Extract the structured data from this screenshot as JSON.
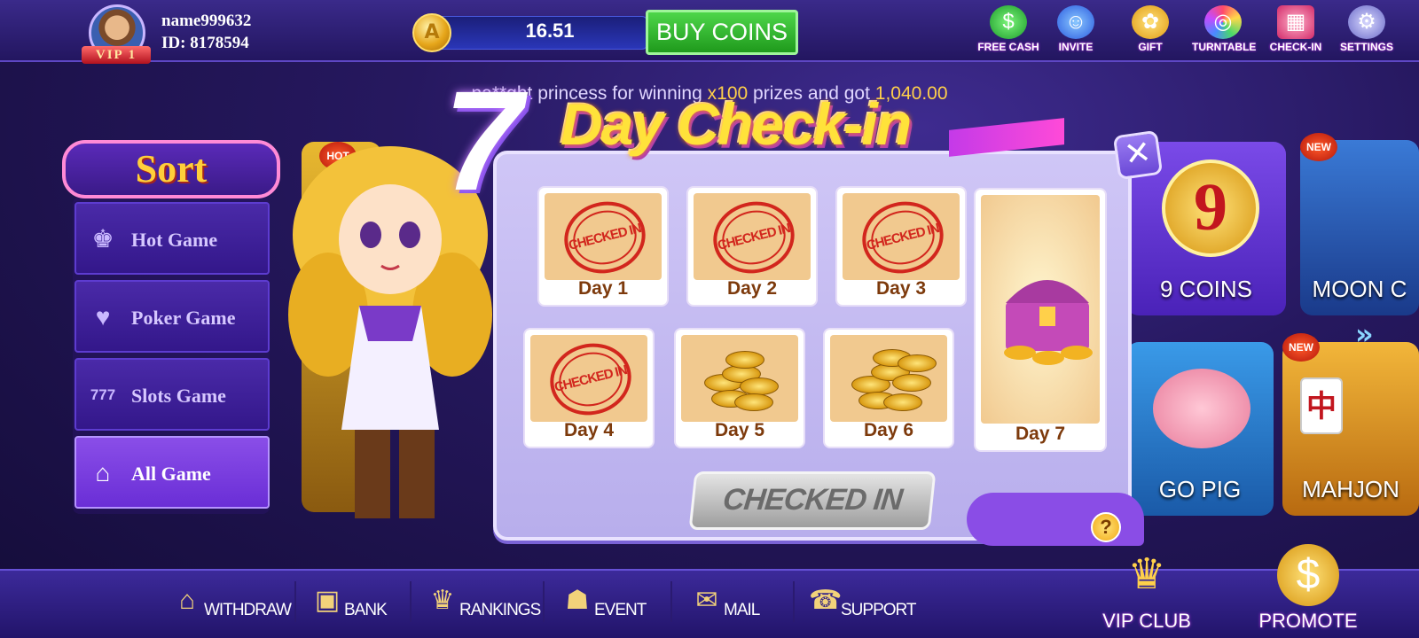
{
  "user": {
    "name": "name999632",
    "id_label": "ID: 8178594",
    "vip": "VIP 1"
  },
  "wallet": {
    "balance": "16.51",
    "coin_symbol": "A",
    "buy_label": "BUY COINS"
  },
  "top_icons": [
    {
      "label": "FREE CASH",
      "icon": "free-cash-icon",
      "glyph": "$"
    },
    {
      "label": "INVITE",
      "icon": "invite-icon",
      "glyph": "☺"
    },
    {
      "label": "GIFT",
      "icon": "gift-icon",
      "glyph": "✿"
    },
    {
      "label": "TURNTABLE",
      "icon": "turntable-icon",
      "glyph": "◎"
    },
    {
      "label": "CHECK-IN",
      "icon": "check-in-icon",
      "glyph": "▦"
    },
    {
      "label": "SETTINGS",
      "icon": "settings-icon",
      "glyph": "⚙"
    }
  ],
  "ticker": {
    "prefix": "na**",
    "game": "ght princess",
    "mid1": " for winning ",
    "mult": "x100",
    "mid2": " prizes and got ",
    "amount": "1,040.00"
  },
  "sort": {
    "logo": "Sort",
    "items": [
      {
        "label": "Hot Game",
        "glyph": "♚"
      },
      {
        "label": "Poker Game",
        "glyph": "♥"
      },
      {
        "label": "Slots Game",
        "glyph": "777"
      },
      {
        "label": "All Game",
        "glyph": "⌂"
      }
    ]
  },
  "tiles": {
    "hot_badge": "HOT",
    "new_badge": "NEW",
    "t1": "9 COINS",
    "t2": "MOON C",
    "t3": "GO PIG",
    "t4": "MAHJON",
    "t1_num": "9"
  },
  "checkin": {
    "seven": "7",
    "title": "Day Check-in",
    "close": "✕",
    "stamp": "CHECKED IN",
    "days": [
      "Day 1",
      "Day 2",
      "Day 3",
      "Day 4",
      "Day 5",
      "Day 6",
      "Day 7"
    ],
    "button": "CHECKED IN",
    "help": "?"
  },
  "bottom_nav": [
    {
      "label": "WITHDRAW",
      "icon": "withdraw-icon",
      "glyph": "⌂"
    },
    {
      "label": "BANK",
      "icon": "bank-icon",
      "glyph": "▣"
    },
    {
      "label": "RANKINGS",
      "icon": "rankings-icon",
      "glyph": "♛"
    },
    {
      "label": "EVENT",
      "icon": "event-icon",
      "glyph": "☗"
    },
    {
      "label": "MAIL",
      "icon": "mail-icon",
      "glyph": "✉"
    },
    {
      "label": "SUPPORT",
      "icon": "support-icon",
      "glyph": "☎"
    }
  ],
  "vip_club": "VIP CLUB",
  "promote": "PROMOTE",
  "colors": {
    "accent": "#ffd04a",
    "gold": "#ffe23a",
    "purple": "#6a2ed6",
    "stamp_red": "#d2261d"
  }
}
